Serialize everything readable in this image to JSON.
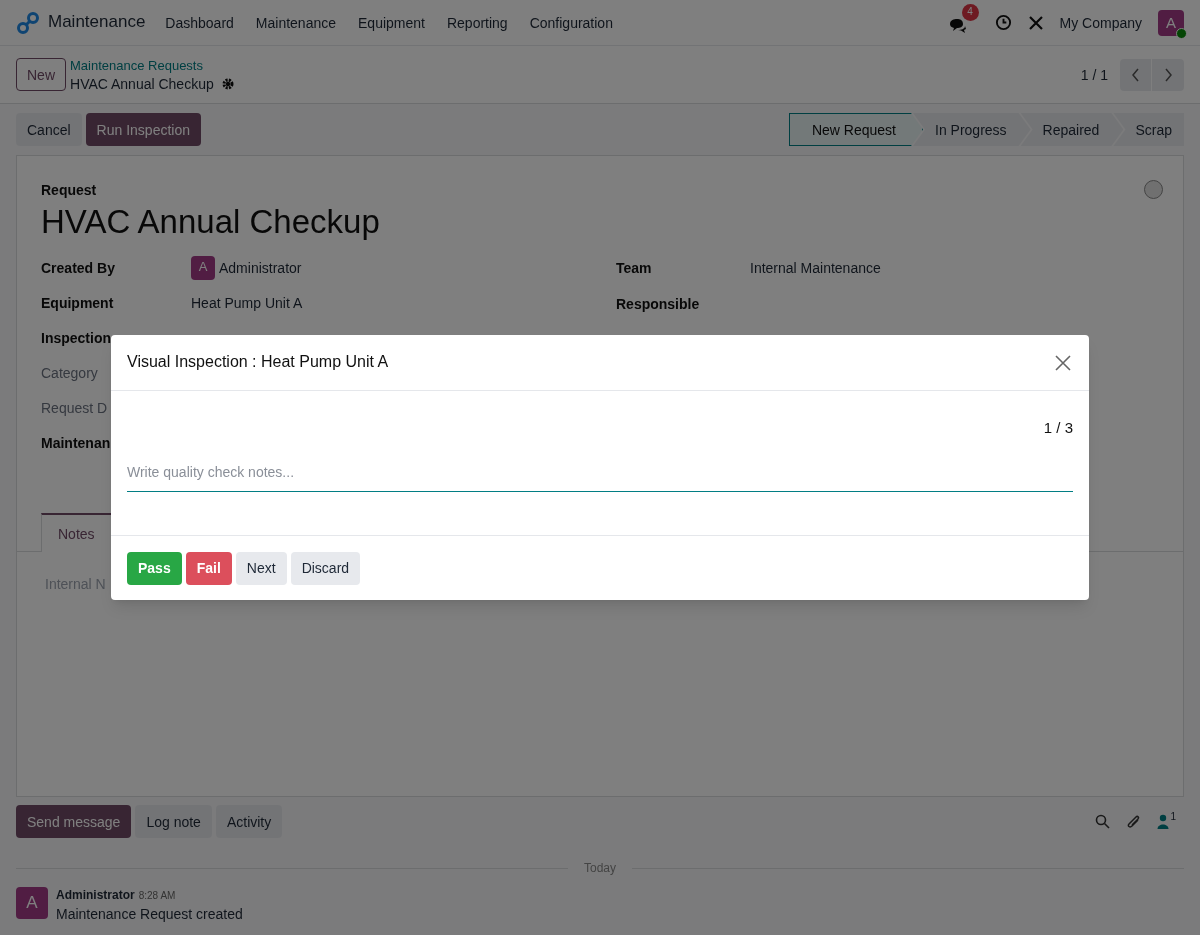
{
  "navbar": {
    "app_name": "Maintenance",
    "menus": [
      "Dashboard",
      "Maintenance",
      "Equipment",
      "Reporting",
      "Configuration"
    ],
    "message_count": "4",
    "company": "My Company",
    "avatar": "A"
  },
  "control_panel": {
    "new_button": "New",
    "breadcrumb": "Maintenance Requests",
    "record": "HVAC Annual Checkup",
    "pager": "1 / 1"
  },
  "actions": [
    {
      "label": "Cancel",
      "primary": false
    },
    {
      "label": "Run Inspection",
      "primary": true
    }
  ],
  "stages": [
    {
      "label": "New Request",
      "selected": true
    },
    {
      "label": "In Progress",
      "selected": false
    },
    {
      "label": "Repaired",
      "selected": false
    },
    {
      "label": "Scrap",
      "selected": false
    }
  ],
  "form": {
    "caption": "Request",
    "title": "HVAC Annual Checkup",
    "left_fields": [
      {
        "label": "Created By",
        "muted": false,
        "value": "Administrator",
        "avatar": "A"
      },
      {
        "label": "Equipment",
        "muted": false,
        "value": "Heat Pump Unit A"
      },
      {
        "label": "Inspection",
        "muted": false
      },
      {
        "label": "Category",
        "muted": true
      },
      {
        "label": "Request D",
        "muted": true
      },
      {
        "label": "Maintenan",
        "muted": false
      }
    ],
    "right_fields": [
      {
        "label": "Team",
        "value": "Internal Maintenance"
      },
      {
        "label": "Responsible"
      }
    ],
    "tabs": [
      {
        "label": "Notes",
        "selected": true
      }
    ],
    "notes_placeholder": "Internal N"
  },
  "dialog": {
    "title": "Visual Inspection : Heat Pump Unit A",
    "counter": "1 / 3",
    "placeholder": "Write quality check notes...",
    "buttons": [
      {
        "label": "Pass",
        "kind": "pass"
      },
      {
        "label": "Fail",
        "kind": "fail"
      },
      {
        "label": "Next",
        "kind": "secondary"
      },
      {
        "label": "Discard",
        "kind": "secondary"
      }
    ]
  },
  "chatter": {
    "buttons": [
      {
        "label": "Send message",
        "primary": true
      },
      {
        "label": "Log note",
        "primary": false
      },
      {
        "label": "Activity",
        "primary": false
      }
    ],
    "follower_count": "1",
    "divider": "Today",
    "messages": [
      {
        "avatar": "A",
        "author": "Administrator",
        "time": "8:28 AM",
        "body": "Maintenance Request created"
      }
    ]
  }
}
